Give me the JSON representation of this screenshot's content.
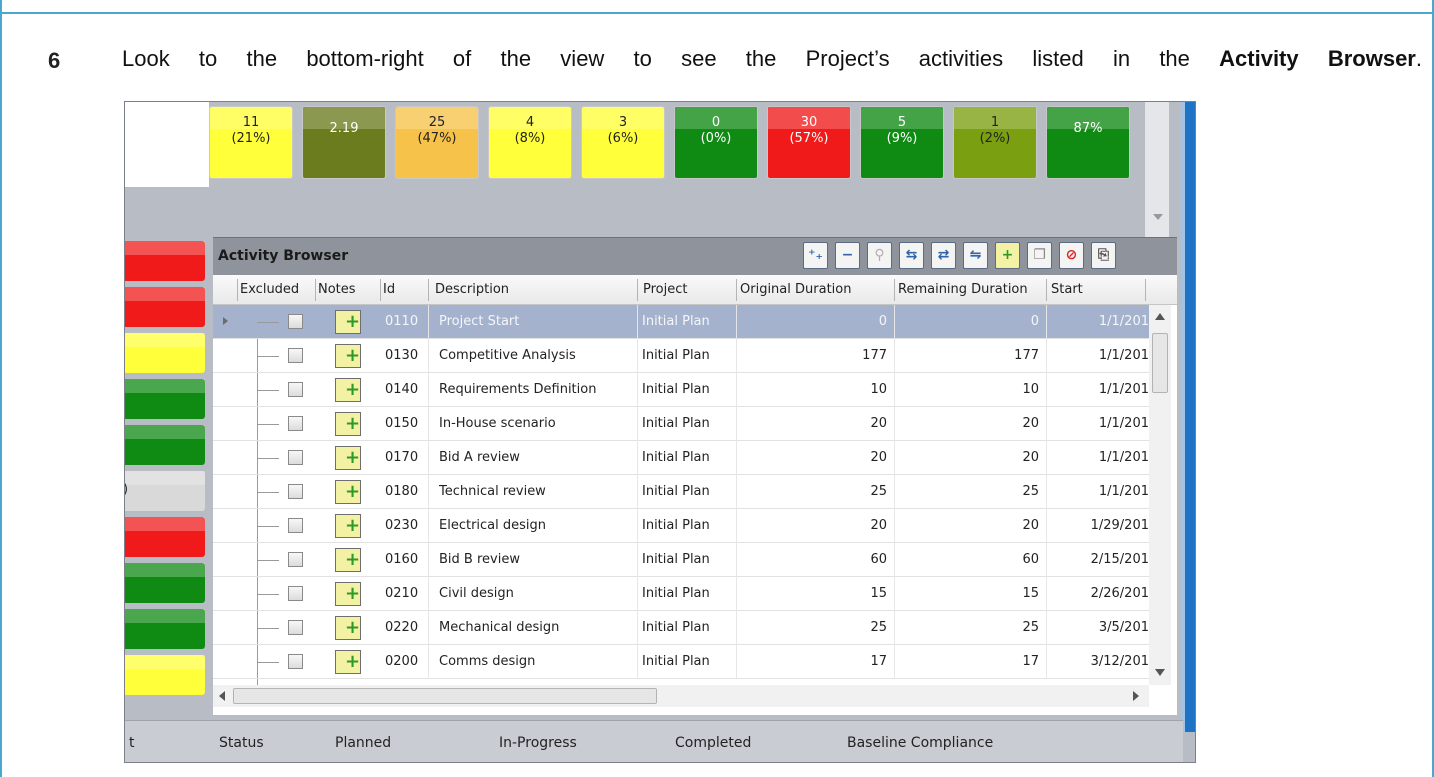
{
  "instruction": {
    "step_number": "6",
    "text_before": "Look to the bottom-right of the view to see the Project’s activities listed in the ",
    "text_bold": "Activity Browser",
    "text_after": "."
  },
  "metrics": [
    {
      "line1": "11",
      "line2": "(21%)",
      "color": "#ffff3a",
      "dark": false
    },
    {
      "line1": "2.19",
      "line2": "",
      "color": "#6b7c1e",
      "dark": true
    },
    {
      "line1": "25",
      "line2": "(47%)",
      "color": "#f7c24a",
      "dark": false
    },
    {
      "line1": "4",
      "line2": "(8%)",
      "color": "#ffff3a",
      "dark": false
    },
    {
      "line1": "3",
      "line2": "(6%)",
      "color": "#ffff3a",
      "dark": false
    },
    {
      "line1": "0",
      "line2": "(0%)",
      "color": "#0f8a13",
      "dark": true
    },
    {
      "line1": "30",
      "line2": "(57%)",
      "color": "#f01a1a",
      "dark": true
    },
    {
      "line1": "5",
      "line2": "(9%)",
      "color": "#0f8a13",
      "dark": true
    },
    {
      "line1": "1",
      "line2": "(2%)",
      "color": "#7a9f10",
      "dark": false
    },
    {
      "line1": "87%",
      "line2": "",
      "color": "#0f8a13",
      "dark": true
    }
  ],
  "left_tiles": [
    "#f01a1a",
    "#f01a1a",
    "#ffff3a",
    "#0f8a13",
    "#0f8a13",
    "#d9d9d9",
    "#f01a1a",
    "#0f8a13",
    "#0f8a13",
    "#ffff3a"
  ],
  "left_partial_char": ")",
  "activity_browser": {
    "title": "Activity Browser",
    "toolbar_icons": [
      "expand-all-icon",
      "collapse-all-icon",
      "filter-icon",
      "link-icon",
      "swap-icon",
      "unlink-icon",
      "add-note-icon",
      "copy-icon",
      "delete-icon",
      "paste-icon"
    ],
    "columns": [
      "Excluded",
      "Notes",
      "Id",
      "Description",
      "Project",
      "Original Duration",
      "Remaining Duration",
      "Start"
    ],
    "rows": [
      {
        "id": "0110",
        "description": "Project Start",
        "project": "Initial  Plan",
        "original": "0",
        "remaining": "0",
        "start": "1/1/201",
        "selected": true
      },
      {
        "id": "0130",
        "description": "Competitive Analysis",
        "project": "Initial  Plan",
        "original": "177",
        "remaining": "177",
        "start": "1/1/201",
        "selected": false
      },
      {
        "id": "0140",
        "description": "Requirements Definition",
        "project": "Initial  Plan",
        "original": "10",
        "remaining": "10",
        "start": "1/1/201",
        "selected": false
      },
      {
        "id": "0150",
        "description": "In-House scenario",
        "project": "Initial  Plan",
        "original": "20",
        "remaining": "20",
        "start": "1/1/201",
        "selected": false
      },
      {
        "id": "0170",
        "description": "Bid A review",
        "project": "Initial  Plan",
        "original": "20",
        "remaining": "20",
        "start": "1/1/201",
        "selected": false
      },
      {
        "id": "0180",
        "description": "Technical review",
        "project": "Initial  Plan",
        "original": "25",
        "remaining": "25",
        "start": "1/1/201",
        "selected": false
      },
      {
        "id": "0230",
        "description": "Electrical design",
        "project": "Initial  Plan",
        "original": "20",
        "remaining": "20",
        "start": "1/29/201",
        "selected": false
      },
      {
        "id": "0160",
        "description": "Bid B review",
        "project": "Initial  Plan",
        "original": "60",
        "remaining": "60",
        "start": "2/15/201",
        "selected": false
      },
      {
        "id": "0210",
        "description": "Civil design",
        "project": "Initial  Plan",
        "original": "15",
        "remaining": "15",
        "start": "2/26/201",
        "selected": false
      },
      {
        "id": "0220",
        "description": "Mechanical design",
        "project": "Initial  Plan",
        "original": "25",
        "remaining": "25",
        "start": "3/5/201",
        "selected": false
      },
      {
        "id": "0200",
        "description": "Comms design",
        "project": "Initial  Plan",
        "original": "17",
        "remaining": "17",
        "start": "3/12/201",
        "selected": false
      }
    ]
  },
  "status_bar": {
    "cut_label": "t",
    "labels": [
      "Status",
      "Planned",
      "In-Progress",
      "Completed",
      "Baseline Compliance"
    ]
  }
}
